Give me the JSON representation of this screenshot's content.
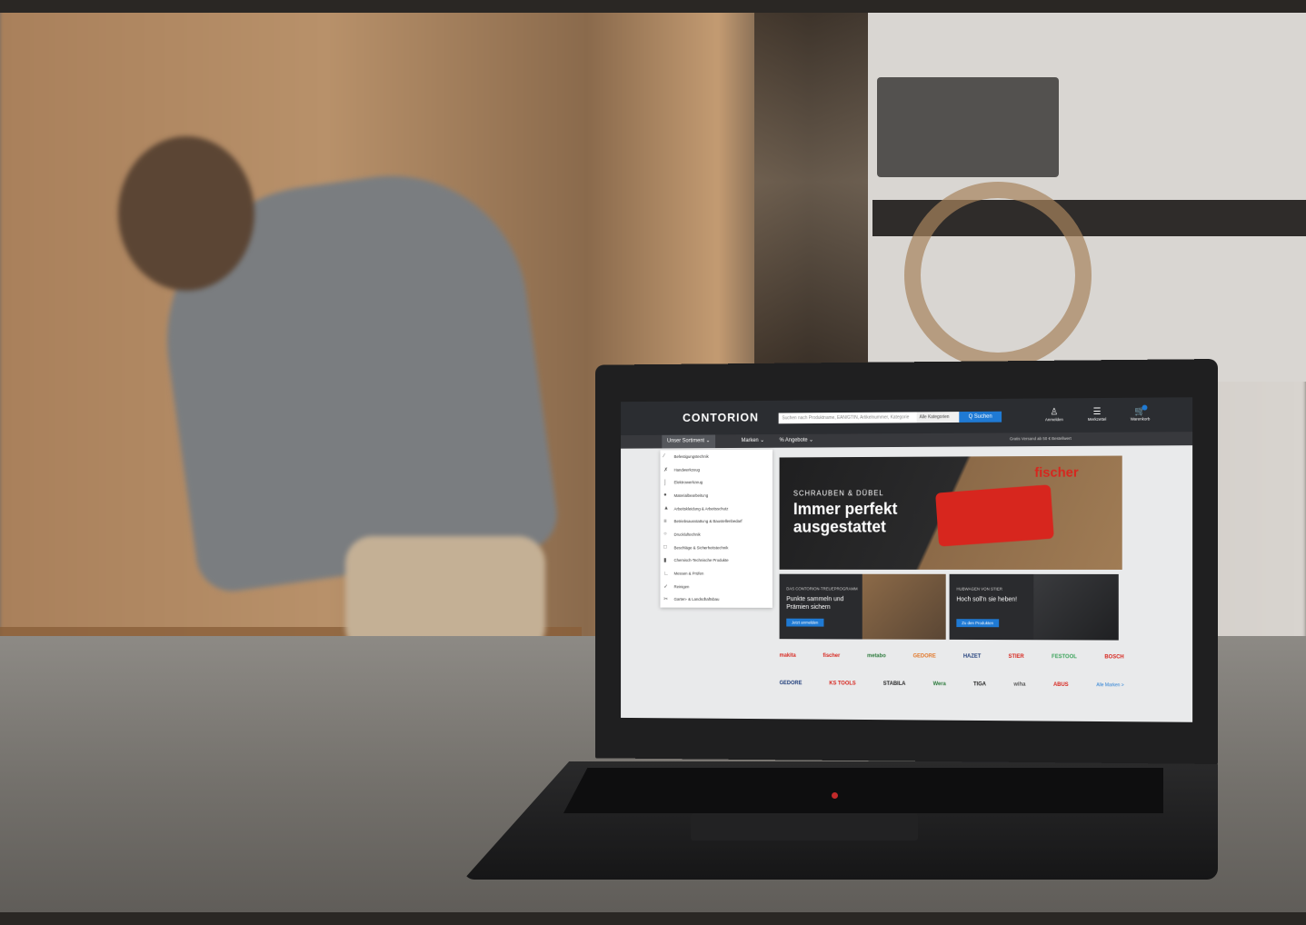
{
  "site": {
    "logo": "CONTORION",
    "search_placeholder": "Suchen nach Produktname, EAN/GTIN, Artikelnummer, Kategorie",
    "category_select": "Alle Kategorien",
    "search_button": "Q Suchen",
    "header_icons": [
      {
        "label": "Anmelden",
        "icon": "user-icon"
      },
      {
        "label": "Merkzettel",
        "icon": "list-icon"
      },
      {
        "label": "Warenkorb",
        "icon": "cart-icon"
      }
    ]
  },
  "nav": {
    "items": [
      "Unser Sortiment",
      "Marken",
      "% Angebote"
    ],
    "note": "Gratis Versand ab 50 € Bestellwert"
  },
  "menu": [
    "Befestigungstechnik",
    "Handwerkzeug",
    "Elektrowerkzeug",
    "Materialbearbeitung",
    "Arbeitskleidung & Arbeitsschutz",
    "Betriebsausstattung & Baustellenbedarf",
    "Druckluftechnik",
    "Beschläge & Sicherheitstechnik",
    "Chemisch-Technische Produkte",
    "Messen & Prüfen",
    "Reinigen",
    "Garten- & Landschaftsbau"
  ],
  "hero": {
    "eyebrow": "SCHRAUBEN & DÜBEL",
    "title": "Immer perfekt ausgestattet",
    "brand": "fischer"
  },
  "promos": [
    {
      "eyebrow": "DAS CONTORION-TREUEPROGRAMM",
      "title": "Punkte sammeln und Prämien sichern",
      "button": "Jetzt anmelden"
    },
    {
      "eyebrow": "HUBWAGEN VON STIER",
      "title": "Hoch soll'n sie heben!",
      "button": "Zu den Produkten"
    }
  ],
  "brands_row1": [
    {
      "name": "makita",
      "color": "#d7261e"
    },
    {
      "name": "fischer",
      "color": "#d7261e"
    },
    {
      "name": "metabo",
      "color": "#2c7a3c"
    },
    {
      "name": "GEDORE",
      "color": "#e2782a"
    },
    {
      "name": "HAZET",
      "color": "#1f3d7a"
    },
    {
      "name": "STIER",
      "color": "#d7261e"
    },
    {
      "name": "FESTOOL",
      "color": "#3aa35a"
    },
    {
      "name": "BOSCH",
      "color": "#d7261e"
    }
  ],
  "brands_row2": [
    {
      "name": "GEDORE",
      "color": "#1f3d7a"
    },
    {
      "name": "KS TOOLS",
      "color": "#d7261e"
    },
    {
      "name": "STABILA",
      "color": "#222222"
    },
    {
      "name": "Wera",
      "color": "#2c7a3c"
    },
    {
      "name": "TIGA",
      "color": "#222222"
    },
    {
      "name": "wiha",
      "color": "#555555"
    },
    {
      "name": "ABUS",
      "color": "#d7261e"
    }
  ],
  "brands_all": "Alle Marken >"
}
